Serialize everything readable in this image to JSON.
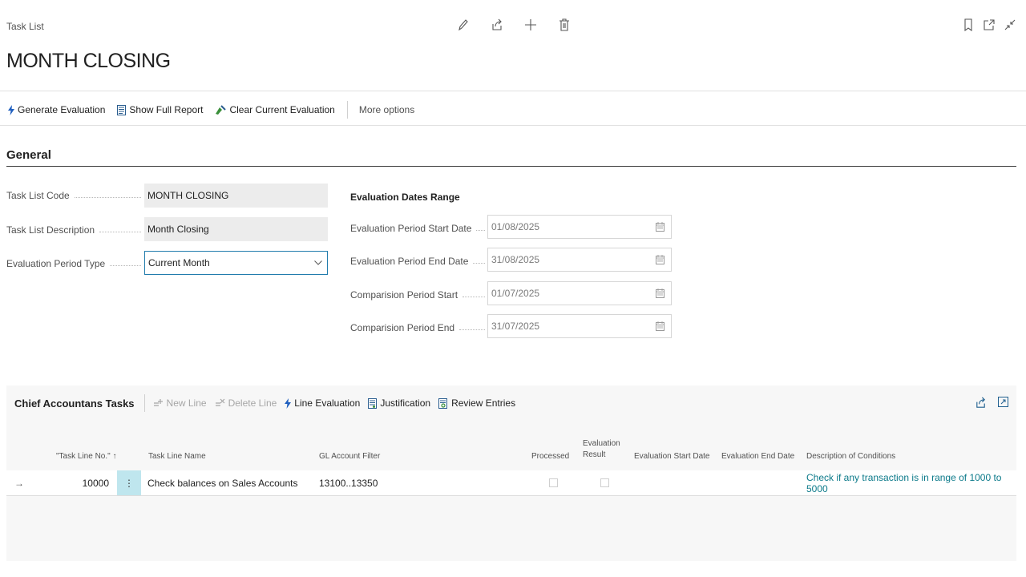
{
  "header": {
    "breadcrumb": "Task List",
    "title": "MONTH CLOSING",
    "page_actions": [
      "pencil-icon",
      "share-icon",
      "plus-icon",
      "trash-icon"
    ],
    "window_actions": [
      "bookmark-icon",
      "open-new-window-icon",
      "collapse-icon"
    ]
  },
  "actionbar": {
    "generate": "Generate Evaluation",
    "show_report": "Show Full Report",
    "clear": "Clear Current Evaluation",
    "more": "More options"
  },
  "general": {
    "title": "General",
    "task_list_code_label": "Task List Code",
    "task_list_code": "MONTH CLOSING",
    "task_list_desc_label": "Task List Description",
    "task_list_desc": "Month Closing",
    "period_type_label": "Evaluation Period Type",
    "period_type": "Current Month",
    "dates_heading": "Evaluation Dates Range",
    "eval_start_label": "Evaluation Period Start Date",
    "eval_start": "01/08/2025",
    "eval_end_label": "Evaluation Period End Date",
    "eval_end": "31/08/2025",
    "comp_start_label": "Comparision Period Start",
    "comp_start": "01/07/2025",
    "comp_end_label": "Comparision Period End",
    "comp_end": "31/07/2025"
  },
  "part": {
    "title": "Chief Accountans Tasks",
    "new_line": "New Line",
    "delete_line": "Delete Line",
    "line_eval": "Line Evaluation",
    "justification": "Justification",
    "review": "Review Entries",
    "columns": {
      "task_line_no": "\"Task Line No.\" ↑",
      "task_line_name": "Task Line Name",
      "gl_filter": "GL Account Filter",
      "processed": "Processed",
      "eval_result_1": "Evaluation",
      "eval_result_2": "Result",
      "eval_start": "Evaluation Start Date",
      "eval_end": "Evaluation End Date",
      "desc": "Description of Conditions"
    },
    "rows": [
      {
        "task_line_no": "10000",
        "task_line_name": "Check balances on Sales Accounts",
        "gl_filter": "13100..13350",
        "processed": false,
        "eval_result": false,
        "eval_start": "",
        "eval_end": "",
        "desc": "Check if any transaction is in range of 1000 to 5000"
      }
    ]
  },
  "colors": {
    "accent": "#217cad",
    "link": "#0c7a8a",
    "lightning": "#1f5fbf"
  }
}
